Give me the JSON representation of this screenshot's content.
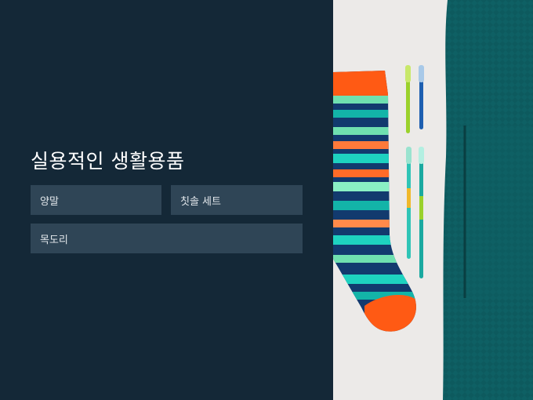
{
  "page": {
    "title": "실용적인 생활용품"
  },
  "items": [
    {
      "label": "양말"
    },
    {
      "label": "칫솔 세트"
    },
    {
      "label": "목도리"
    }
  ],
  "colors": {
    "background": "#142837",
    "chip": "#2f4556",
    "chip_text": "#e3e8ec",
    "title_text": "#ffffff"
  }
}
